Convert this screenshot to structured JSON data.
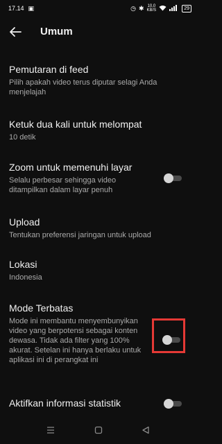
{
  "status_bar": {
    "time": "17.14",
    "net_speed_value": "10,0",
    "net_speed_unit": "KB/S",
    "battery": "29"
  },
  "header": {
    "title": "Umum"
  },
  "settings": [
    {
      "label": "Pemutaran di feed",
      "desc": "Pilih apakah video terus diputar selagi Anda menjelajah"
    },
    {
      "label": "Ketuk dua kali untuk melompat",
      "desc": "10 detik"
    },
    {
      "label": "Zoom untuk memenuhi layar",
      "desc": "Selalu perbesar sehingga video ditampilkan dalam layar penuh",
      "toggle": false
    },
    {
      "label": "Upload",
      "desc": "Tentukan preferensi jaringan untuk upload"
    },
    {
      "label": "Lokasi",
      "desc": "Indonesia"
    },
    {
      "label": "Mode Terbatas",
      "desc": "Mode ini membantu menyembunyikan video yang berpotensi sebagai konten dewasa. Tidak ada filter yang 100% akurat. Setelan ini hanya berlaku untuk aplikasi ini di perangkat ini",
      "toggle": false
    },
    {
      "label": "Aktifkan informasi statistik",
      "toggle": false
    }
  ],
  "highlight_color": "#e53935",
  "icons": {
    "back": "arrow-left-icon",
    "notification": "bag-icon",
    "alarm": "alarm-icon",
    "bluetooth": "bluetooth-icon",
    "wifi": "wifi-icon",
    "signal": "signal-icon",
    "nav_recents": "menu-icon",
    "nav_home": "square-icon",
    "nav_back": "triangle-back-icon"
  }
}
